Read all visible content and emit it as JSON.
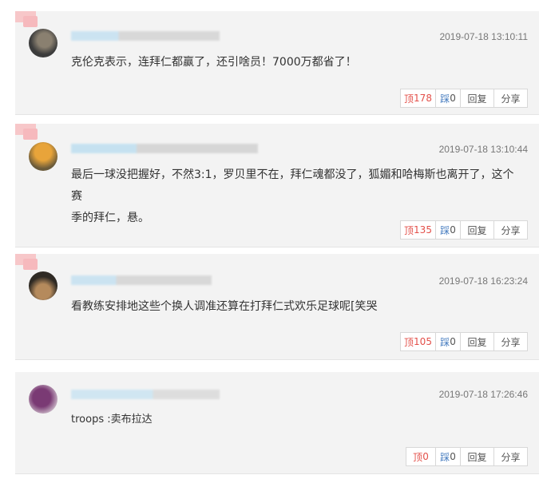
{
  "comments": [
    {
      "time": "2019-07-18 13:10:11",
      "text": "克伦克表示，连拜仁都赢了，还引啥员！7000万都省了！",
      "up_label": "顶",
      "up_count": "178",
      "down_label": "踩",
      "down_count": "0",
      "reply": "回复",
      "share": "分享",
      "avatar_colors": [
        "#3c3c3c",
        "#8a8070"
      ]
    },
    {
      "time": "2019-07-18 13:10:44",
      "text": "最后一球没把握好，不然3:1，罗贝里不在，拜仁魂都没了，狐媚和哈梅斯也离开了，这个赛\n季的拜仁，悬。",
      "up_label": "顶",
      "up_count": "135",
      "down_label": "踩",
      "down_count": "0",
      "reply": "回复",
      "share": "分享",
      "avatar_colors": [
        "#e8a43a",
        "#6a5a3a"
      ]
    },
    {
      "time": "2019-07-18 16:23:24",
      "text": "看教练安排地这些个换人调准还算在打拜仁式欢乐足球呢[笑哭",
      "up_label": "顶",
      "up_count": "105",
      "down_label": "踩",
      "down_count": "0",
      "reply": "回复",
      "share": "分享",
      "avatar_colors": [
        "#2f2a24",
        "#b58a5c"
      ]
    },
    {
      "time": "2019-07-18 17:26:46",
      "text": "troops :卖布拉达",
      "up_label": "顶",
      "up_count": "0",
      "down_label": "踩",
      "down_count": "0",
      "reply": "回复",
      "share": "分享",
      "avatar_colors": [
        "#7a3a74",
        "#c9b6c6"
      ]
    }
  ]
}
